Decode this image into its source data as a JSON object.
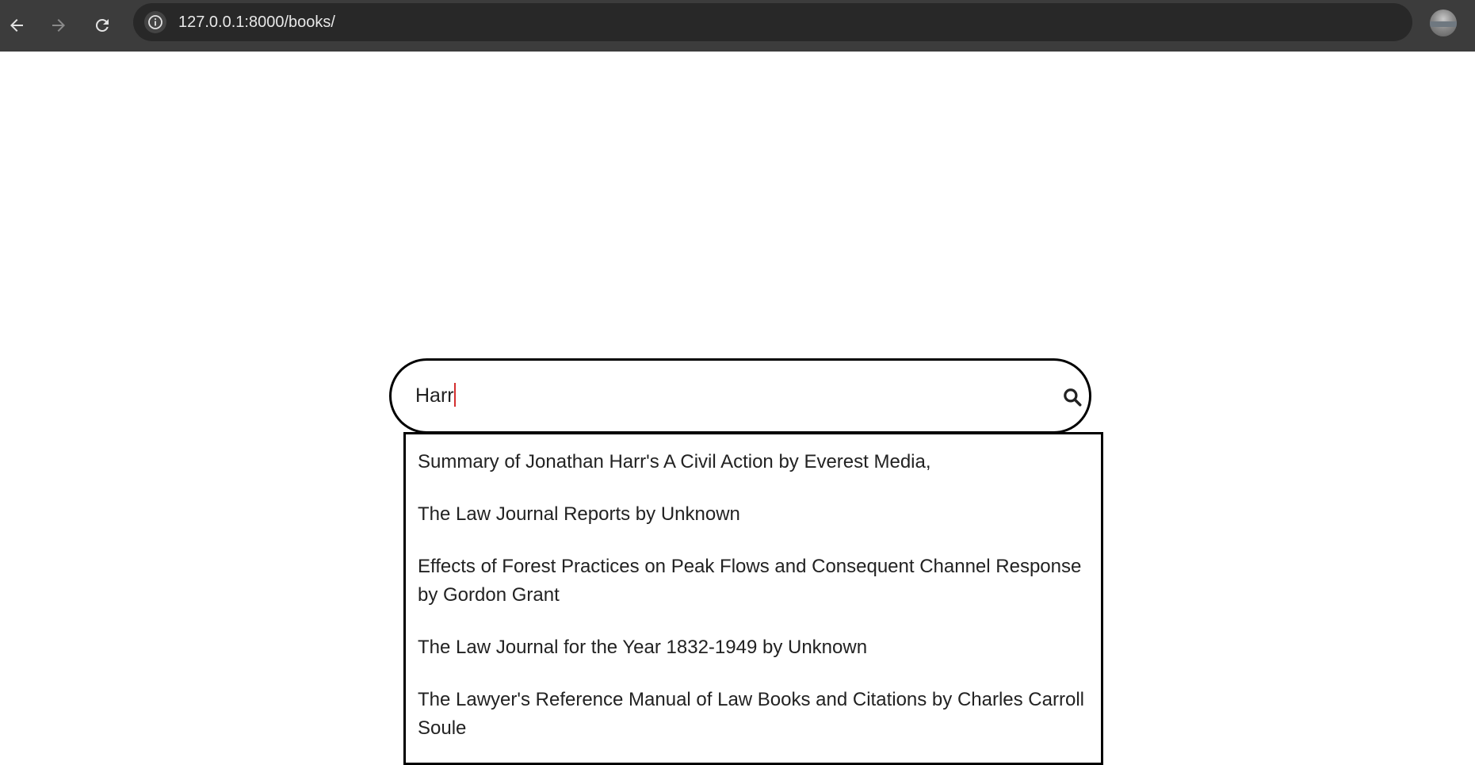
{
  "browser": {
    "url": "127.0.0.1:8000/books/"
  },
  "search": {
    "value": "Harr"
  },
  "suggestions": [
    "Summary of Jonathan Harr's A Civil Action by Everest Media,",
    "The Law Journal Reports by Unknown",
    "Effects of Forest Practices on Peak Flows and Consequent Channel Response by Gordon Grant",
    "The Law Journal for the Year 1832-1949 by Unknown",
    "The Lawyer's Reference Manual of Law Books and Citations by Charles Carroll Soule"
  ],
  "colors": {
    "toolbar": "#3c3c3c",
    "omnibox": "#282828",
    "border": "#000000",
    "caret": "#d32f2f"
  }
}
